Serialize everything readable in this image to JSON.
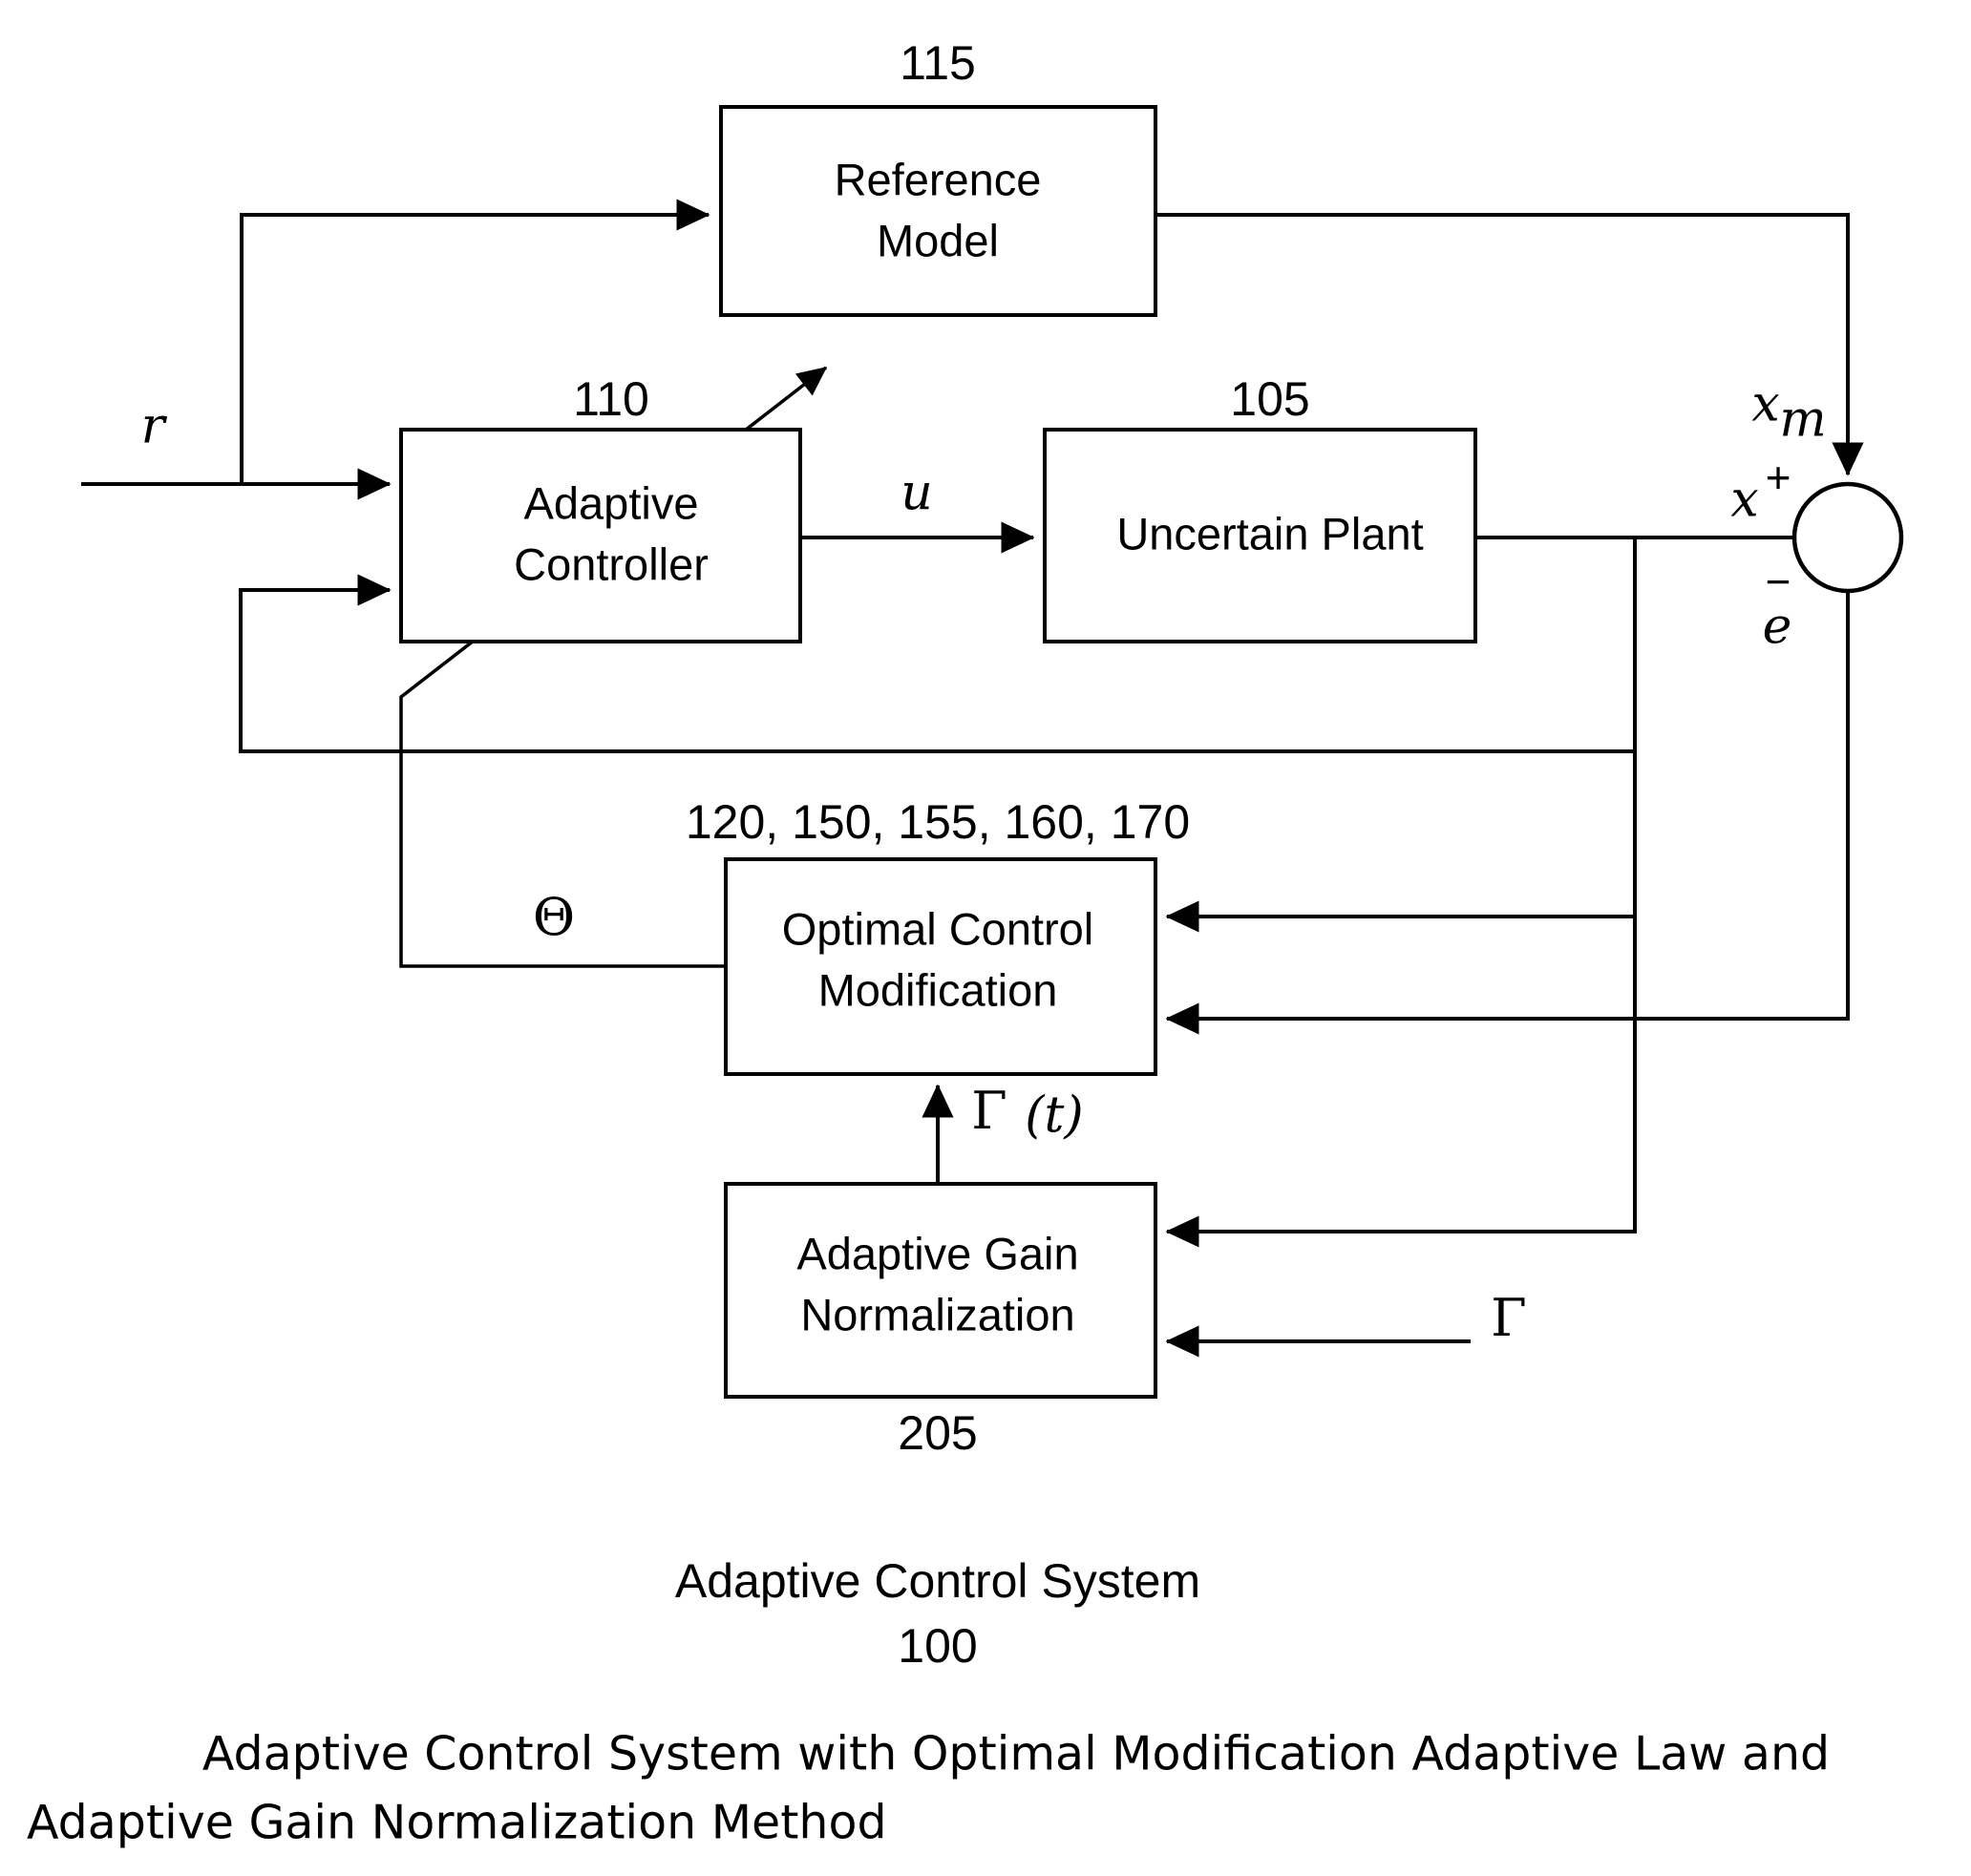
{
  "figure": {
    "title_line1": "Adaptive Control System",
    "title_line2": "100",
    "caption_line1": "Adaptive Control System with Optimal Modification Adaptive Law and",
    "caption_line2": "Adaptive Gain Normalization Method"
  },
  "blocks": {
    "reference_model": {
      "ref": "115",
      "label_line1": "Reference",
      "label_line2": "Model"
    },
    "adaptive_controller": {
      "ref": "110",
      "label_line1": "Adaptive",
      "label_line2": "Controller"
    },
    "uncertain_plant": {
      "ref": "105",
      "label_line1": "Uncertain Plant"
    },
    "optimal_control_modification": {
      "ref": "120, 150, 155, 160, 170",
      "label_line1": "Optimal Control",
      "label_line2": "Modification"
    },
    "adaptive_gain_normalization": {
      "ref": "205",
      "label_line1": "Adaptive Gain",
      "label_line2": "Normalization"
    }
  },
  "signals": {
    "reference_input": "r",
    "control_input": "u",
    "model_state": "x",
    "model_state_sub": "m",
    "plant_state": "x",
    "error": "e",
    "theta": "Θ",
    "gamma_of_t_sym": "Γ",
    "gamma_of_t_arg": "(t)",
    "gamma": "Γ",
    "plus_sign": "+",
    "minus_sign": "−"
  },
  "colors": {
    "stroke": "#000000",
    "background": "#ffffff",
    "fill": "#ffffff"
  }
}
